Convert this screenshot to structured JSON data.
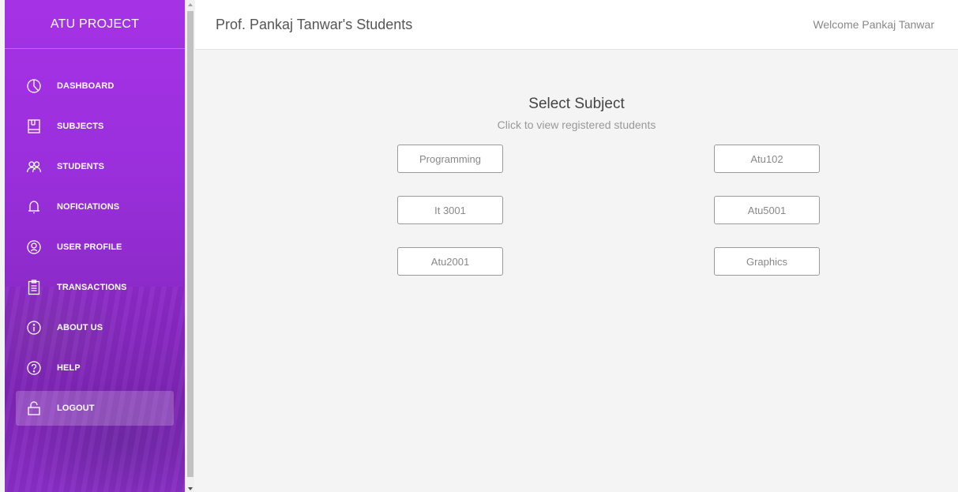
{
  "sidebar": {
    "brand": "ATU PROJECT",
    "items": [
      {
        "label": "DASHBOARD",
        "icon": "pie-chart-icon"
      },
      {
        "label": "SUBJECTS",
        "icon": "book-icon"
      },
      {
        "label": "STUDENTS",
        "icon": "users-icon"
      },
      {
        "label": "NOFICIATIONS",
        "icon": "bell-icon"
      },
      {
        "label": "USER PROFILE",
        "icon": "user-circle-icon"
      },
      {
        "label": "TRANSACTIONS",
        "icon": "clipboard-icon"
      },
      {
        "label": "ABOUT US",
        "icon": "info-icon"
      },
      {
        "label": "HELP",
        "icon": "help-icon"
      },
      {
        "label": "LOGOUT",
        "icon": "lock-icon",
        "active": true
      }
    ],
    "accent": "#9c2fe0"
  },
  "header": {
    "title": "Prof. Pankaj Tanwar's Students",
    "welcome": "Welcome Pankaj Tanwar"
  },
  "main": {
    "heading": "Select Subject",
    "subheading": "Click to view registered students",
    "subjects": [
      "Programming",
      "Atu102",
      "It 3001",
      "Atu5001",
      "Atu2001",
      "Graphics"
    ]
  }
}
